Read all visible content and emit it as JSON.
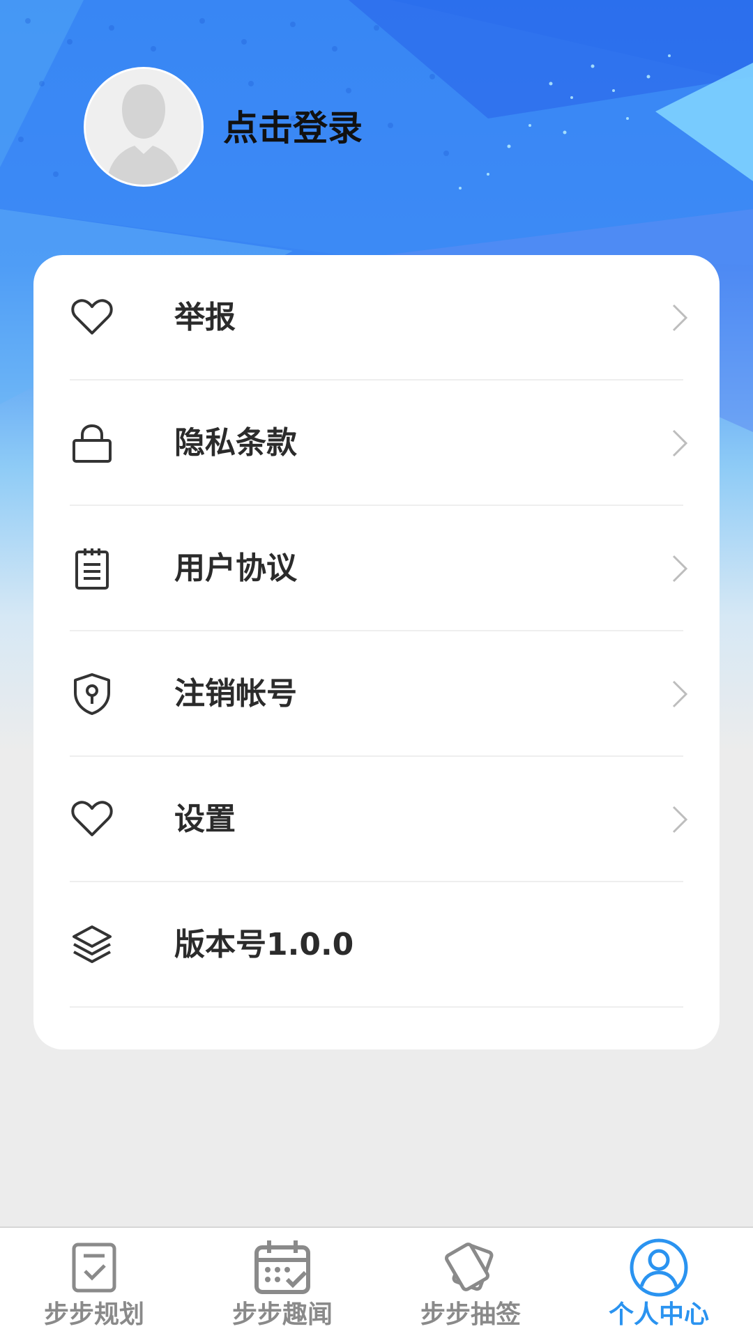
{
  "profile": {
    "login_label": "点击登录"
  },
  "menu": {
    "items": [
      {
        "label": "举报",
        "icon": "heart-icon"
      },
      {
        "label": "隐私条款",
        "icon": "bag-icon"
      },
      {
        "label": "用户协议",
        "icon": "document-icon"
      },
      {
        "label": "注销帐号",
        "icon": "shield-keyhole-icon"
      },
      {
        "label": "设置",
        "icon": "heart-icon"
      },
      {
        "label": "版本号1.0.0",
        "icon": "layers-icon"
      }
    ]
  },
  "tabbar": {
    "tabs": [
      {
        "label": "步步规划",
        "icon": "checklist-icon"
      },
      {
        "label": "步步趣闻",
        "icon": "calendar-icon"
      },
      {
        "label": "步步抽签",
        "icon": "cards-icon"
      },
      {
        "label": "个人中心",
        "icon": "user-circle-icon",
        "active": true
      }
    ],
    "active_color": "#2a93f0",
    "inactive_color": "#8a8a8a"
  },
  "colors": {
    "header_blue": "#2f7df2",
    "page_bg": "#ececec"
  }
}
